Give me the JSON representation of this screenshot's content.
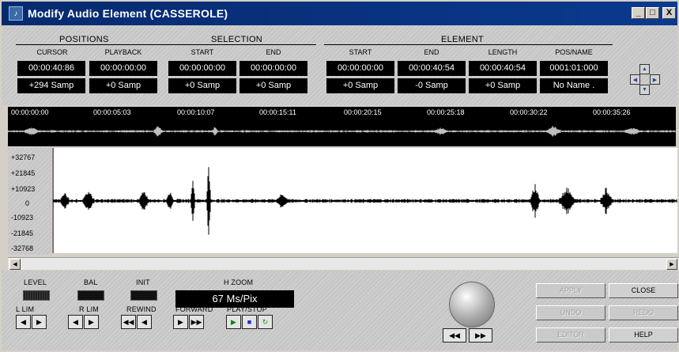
{
  "window": {
    "title": "Modify Audio Element (CASSEROLE)",
    "min": "_",
    "max": "□",
    "close": "X"
  },
  "groups": {
    "positions": "POSITIONS",
    "selection": "SELECTION",
    "element": "ELEMENT"
  },
  "columns": {
    "cursor": {
      "label": "CURSOR",
      "time": "00:00:40:86",
      "samp": "+294 Samp"
    },
    "playback": {
      "label": "PLAYBACK",
      "time": "00:00:00:00",
      "samp": "+0 Samp"
    },
    "sel_start": {
      "label": "START",
      "time": "00:00:00:00",
      "samp": "+0 Samp"
    },
    "sel_end": {
      "label": "END",
      "time": "00:00:00:00",
      "samp": "+0 Samp"
    },
    "el_start": {
      "label": "START",
      "time": "00:00:00:00",
      "samp": "+0 Samp"
    },
    "el_end": {
      "label": "END",
      "time": "00:00:40:54",
      "samp": "-0 Samp"
    },
    "el_length": {
      "label": "LENGTH",
      "time": "00:00:40:54",
      "samp": "+0 Samp"
    },
    "posname": {
      "label": "POS/NAME",
      "time": "0001:01:000",
      "samp": "No Name ."
    }
  },
  "ruler": [
    "00:00:00:00",
    "00:00:05:03",
    "00:00:10:07",
    "00:00:15:11",
    "00:00:20:15",
    "00:00:25:18",
    "00:00:30:22",
    "00:00:35:26"
  ],
  "yaxis": [
    "+32767",
    "+21845",
    "+10923",
    "0",
    "-10923",
    "-21845",
    "-32768"
  ],
  "controls": {
    "level": "LEVEL",
    "bal": "BAL",
    "init": "INIT",
    "hzoom_label": "H ZOOM",
    "hzoom_value": "67 Ms/Pix",
    "llim": "L LIM",
    "rlim": "R LIM",
    "rewind": "REWIND",
    "forward": "FORWARD",
    "playstop": "PLAY/STOP"
  },
  "buttons": {
    "apply": "APPLY",
    "close": "CLOSE",
    "undo": "UNDO",
    "redo": "REDO",
    "editor": "EDITOR",
    "help": "HELP"
  },
  "colors": {
    "title_bar": "#062a6e",
    "waveform": "#000000",
    "cursor_line": "#e03030",
    "play_icon": "#0a8a0a",
    "stop_icon": "#1a2ad0"
  }
}
